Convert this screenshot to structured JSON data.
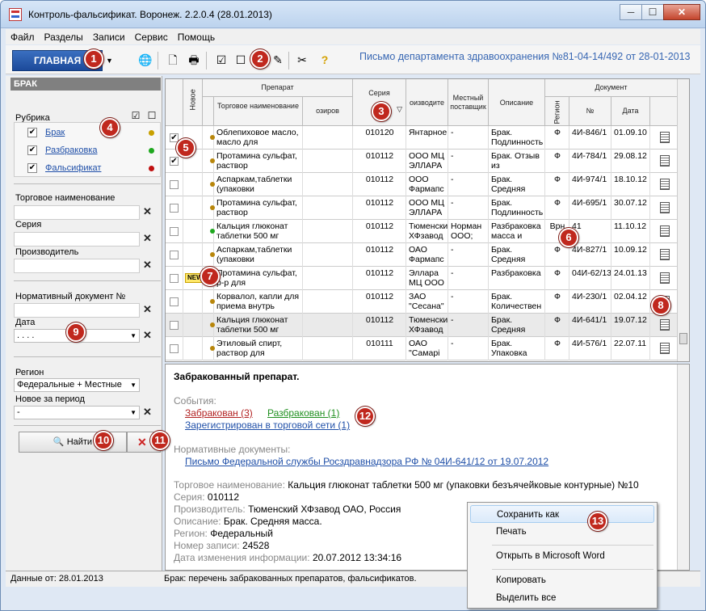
{
  "window": {
    "title": "Контроль-фальсификат. Воронеж. 2.2.0.4 (28.01.2013)",
    "min": "─",
    "max": "☐",
    "close": "✕"
  },
  "menu": [
    "Файл",
    "Разделы",
    "Записи",
    "Сервис",
    "Помощь"
  ],
  "toolbar": {
    "main_label": "ГЛАВНАЯ",
    "letter": "Письмо департамента здравоохранения №81-04-14/492 от 28-01-2013"
  },
  "badges": [
    "1",
    "2",
    "3",
    "4",
    "5",
    "6",
    "7",
    "8",
    "9",
    "10",
    "11",
    "12",
    "13"
  ],
  "left": {
    "header": "БРАК",
    "rubric_label": "Рубрика",
    "rubrics": [
      {
        "label": "Брак",
        "checked": "✔",
        "color": "#c8a000"
      },
      {
        "label": "Разбраковка",
        "checked": "✔",
        "color": "#1fa81f"
      },
      {
        "label": "Фальсификат",
        "checked": "✔",
        "color": "#c01010"
      }
    ],
    "trade_name_label": "Торговое наименование",
    "series_label": "Серия",
    "manufacturer_label": "Производитель",
    "normdoc_label": "Нормативный документ №",
    "date_label": "Дата",
    "date_value": ". .           . .",
    "region_label": "Регион",
    "region_value": "Федеральные + Местные",
    "new_period_label": "Новое за период",
    "new_period_value": "-",
    "find_label": "Найти",
    "clear_icon": "✕",
    "x": "✕"
  },
  "grid": {
    "headers": {
      "new": "Новое",
      "drug": "Препарат",
      "trade": "Торговое наименование",
      "dosage": "озиров",
      "series": "Серия",
      "manuf": "оизводите",
      "local": "Местный поставщик",
      "desc": "Описание",
      "doc": "Документ",
      "region": "Регион",
      "num": "№",
      "date": "Дата"
    },
    "rows": [
      {
        "chk": "✔",
        "new": "",
        "dot": "#b8860b",
        "trade": "Облепиховое масло, масло для",
        "series": "010120",
        "manuf": "Янтарное",
        "local": "-",
        "desc": "Брак. Подлинность",
        "region": "Ф",
        "num": "4И-846/1",
        "date": "01.09.10"
      },
      {
        "chk": "✔",
        "new": "",
        "dot": "#b8860b",
        "trade": "Протамина сульфат, раствор",
        "series": "010112",
        "manuf": "ООО МЦ ЭЛЛАРА",
        "local": "-",
        "desc": "Брак. Отзыв из",
        "region": "Ф",
        "num": "4И-784/1",
        "date": "29.08.12"
      },
      {
        "chk": "",
        "new": "",
        "dot": "#b8860b",
        "trade": "Аспаркам,таблетки (упаковки",
        "series": "010112",
        "manuf": "ООО Фармапс",
        "local": "-",
        "desc": "Брак. Средняя",
        "region": "Ф",
        "num": "4И-974/1",
        "date": "18.10.12"
      },
      {
        "chk": "",
        "new": "",
        "dot": "#b8860b",
        "trade": "Протамина сульфат, раствор",
        "series": "010112",
        "manuf": "ООО МЦ ЭЛЛАРА",
        "local": "-",
        "desc": "Брак. Подлинность",
        "region": "Ф",
        "num": "4И-695/1",
        "date": "30.07.12"
      },
      {
        "chk": "",
        "new": "",
        "dot": "#1fa81f",
        "trade": "Кальция глюконат таблетки 500 мг",
        "series": "010112",
        "manuf": "Тюменски ХФзавод",
        "local": "Норман ООО;",
        "desc": "Разбраковка масса и",
        "region": "Врн",
        "num": "41",
        "date": "11.10.12"
      },
      {
        "chk": "",
        "new": "",
        "dot": "#b8860b",
        "trade": "Аспаркам,таблетки (упаковки",
        "series": "010112",
        "manuf": "ОАО Фармапс",
        "local": "-",
        "desc": "Брак. Средняя",
        "region": "Ф",
        "num": "4И-827/1",
        "date": "10.09.12"
      },
      {
        "chk": "",
        "new": "NEW",
        "dot": "#b8860b",
        "trade": "Протамина сульфат, р-р для",
        "series": "010112",
        "manuf": "Эллара МЦ ООО",
        "local": "-",
        "desc": "Разбраковка",
        "region": "Ф",
        "num": "04И-62/13",
        "date": "24.01.13"
      },
      {
        "chk": "",
        "new": "",
        "dot": "#b8860b",
        "trade": "Корвалол, капли для приема внутрь",
        "series": "010112",
        "manuf": "ЗАО \"Сесана\"",
        "local": "-",
        "desc": "Брак. Количествен",
        "region": "Ф",
        "num": "4И-230/1",
        "date": "02.04.12"
      },
      {
        "chk": "",
        "new": "",
        "dot": "#b8860b",
        "trade": "Кальция глюконат таблетки 500 мг",
        "series": "010112",
        "manuf": "Тюменски ХФзавод",
        "local": "-",
        "desc": "Брак. Средняя",
        "region": "Ф",
        "num": "4И-641/1",
        "date": "19.07.12"
      },
      {
        "chk": "",
        "new": "",
        "dot": "#b8860b",
        "trade": "Этиловый спирт, раствор для",
        "series": "010111",
        "manuf": "ОАО \"Самарі",
        "local": "-",
        "desc": "Брак. Упаковка",
        "region": "Ф",
        "num": "4И-576/1",
        "date": "22.07.11"
      }
    ]
  },
  "detail": {
    "title": "Забракованный препарат.",
    "events_label": "События:",
    "ev_rejected": "Забракован (3)",
    "ev_unrejected": "Разбракован (1)",
    "ev_registered": "Зарегистрирован в торговой сети (1)",
    "normdocs_label": "Нормативные документы:",
    "normdoc_link": "Письмо Федеральной службы Росздравнадзора РФ № 04И-641/12 от 19.07.2012",
    "fields": [
      {
        "k": "Торговое наименование:",
        "v": "Кальция глюконат таблетки 500 мг (упаковки безъячейковые контурные) №10"
      },
      {
        "k": "Серия:",
        "v": "010112"
      },
      {
        "k": "Производитель:",
        "v": "Тюменский ХФзавод ОАО, Россия"
      },
      {
        "k": "Описание:",
        "v": "Брак. Средняя масса."
      },
      {
        "k": "Регион:",
        "v": "Федеральный"
      },
      {
        "k": "Номер записи:",
        "v": "24528"
      },
      {
        "k": "Дата изменения информации:",
        "v": "20.07.2012 13:34:16"
      }
    ]
  },
  "status": {
    "left": "Данные от: 28.01.2013",
    "right": "Брак: перечень забракованных препаратов, фальсификатов."
  },
  "context_menu": [
    "Сохранить как",
    "Печать",
    "Открыть в Microsoft Word",
    "Копировать",
    "Выделить все"
  ]
}
